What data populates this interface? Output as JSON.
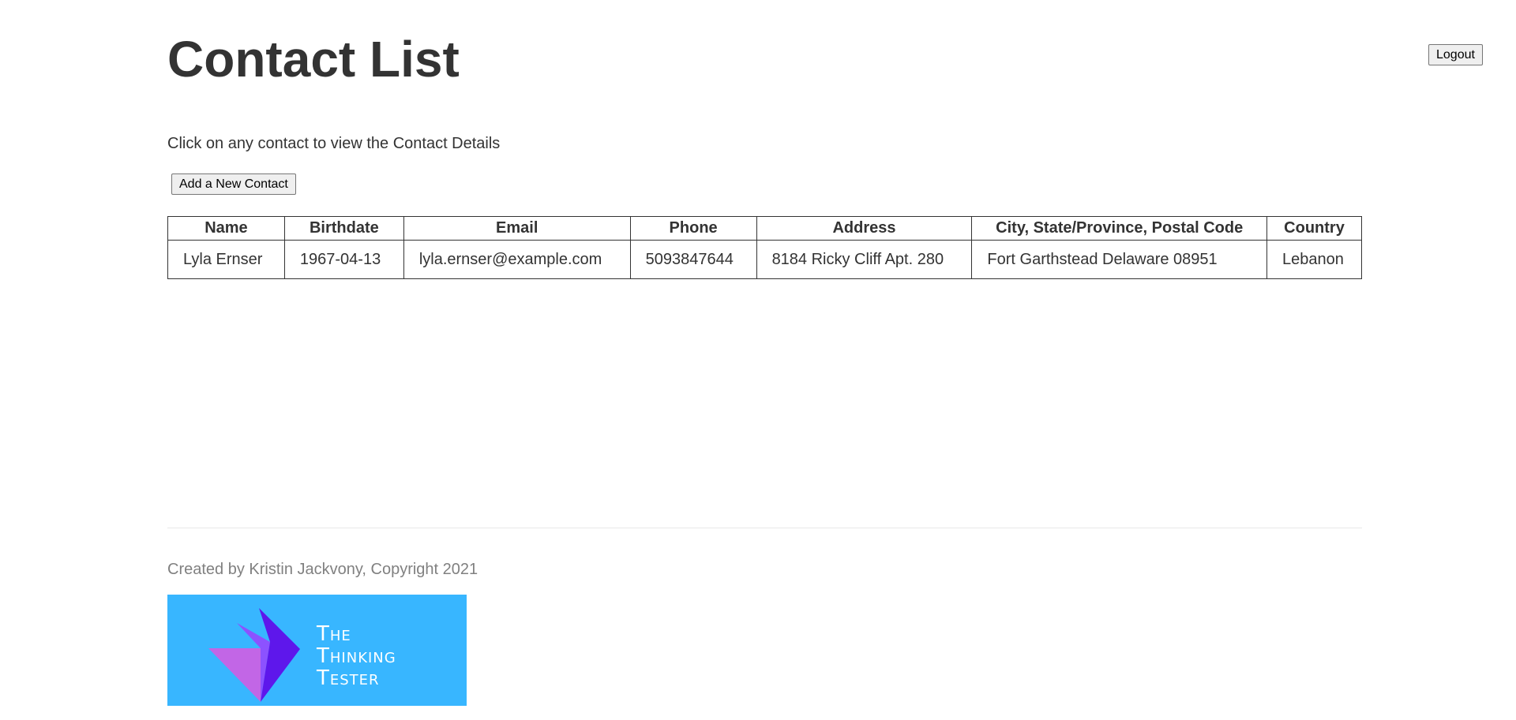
{
  "header": {
    "title": "Contact List",
    "logout_label": "Logout"
  },
  "main": {
    "instructions": "Click on any contact to view the Contact Details",
    "add_contact_label": "Add a New Contact",
    "table": {
      "columns": [
        "Name",
        "Birthdate",
        "Email",
        "Phone",
        "Address",
        "City, State/Province, Postal Code",
        "Country"
      ],
      "rows": [
        [
          "Lyla Ernser",
          "1967-04-13",
          "lyla.ernser@example.com",
          "5093847644",
          "8184 Ricky Cliff Apt. 280",
          "Fort Garthstead Delaware 08951",
          "Lebanon"
        ]
      ]
    }
  },
  "footer": {
    "credit": "Created by Kristin Jackvony, Copyright 2021",
    "logo_text": [
      "The",
      "Thinking",
      "Tester"
    ]
  },
  "colors": {
    "text": "#333333",
    "footer_text": "#808080",
    "logo_bg": "#38b6ff",
    "logo_purple_light": "#c266e6",
    "logo_purple_mid": "#8c52ff",
    "logo_purple_dark": "#5e17eb"
  }
}
